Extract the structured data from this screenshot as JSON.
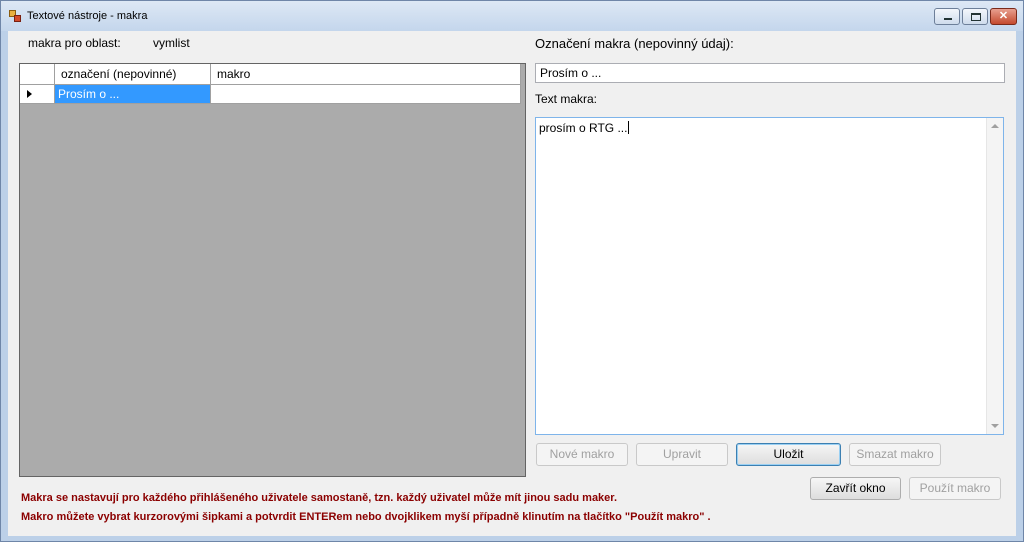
{
  "window": {
    "title": "Textové nástroje - makra",
    "controls": [
      "minimize-icon",
      "maximize-icon",
      "close-icon"
    ]
  },
  "area": {
    "label": "makra pro oblast:",
    "value": "vymlist"
  },
  "grid": {
    "columns": [
      "označení (nepovinné)",
      "makro"
    ],
    "rows": [
      {
        "oznaceni": "Prosím o ...",
        "makro": ""
      }
    ],
    "selected_row": 0
  },
  "form": {
    "label_label": "Označení makra (nepovinný údaj):",
    "label_value": "Prosím o ...",
    "text_label": "Text makra:",
    "text_value": "prosím o RTG ..."
  },
  "buttons": {
    "new": "Nové  makro",
    "edit": "Upravit",
    "save": "Uložit",
    "delete": "Smazat makro",
    "close": "Zavřít okno",
    "use": "Použít makro"
  },
  "notes": [
    "Makra se nastavují pro každého přihlášeného uživatele samostaně, tzn. každý uživatel  může mít jinou sadu maker.",
    "Makro můžete vybrat kurzorovými šipkami a potvrdit ENTERem nebo dvojklikem myší případně klinutím na tlačítko \"Použít makro\" ."
  ],
  "colors": {
    "selection": "#3399ff",
    "grid_background": "#ababab",
    "note_text": "#8b0000",
    "focus_border": "#7eb4ea"
  }
}
